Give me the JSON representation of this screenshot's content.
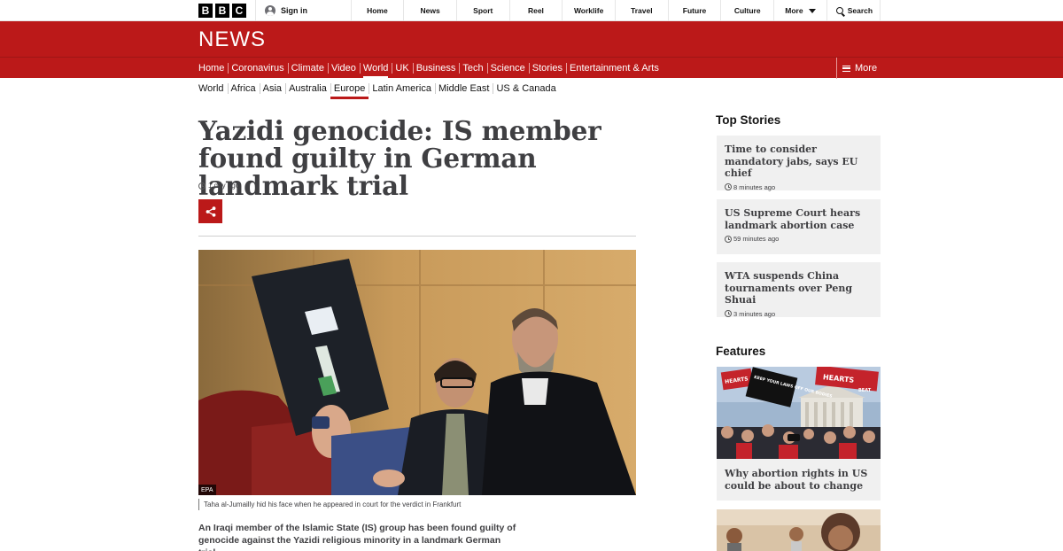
{
  "global_nav": {
    "logo_letters": [
      "B",
      "B",
      "C"
    ],
    "sign_in": "Sign in",
    "items": [
      "Home",
      "News",
      "Sport",
      "Reel",
      "Worklife",
      "Travel",
      "Future",
      "Culture"
    ],
    "more": "More",
    "search": "Search"
  },
  "masthead": {
    "title": "NEWS",
    "brand_color": "#bb1919"
  },
  "news_nav": {
    "items": [
      "Home",
      "Coronavirus",
      "Climate",
      "Video",
      "World",
      "UK",
      "Business",
      "Tech",
      "Science",
      "Stories",
      "Entertainment & Arts"
    ],
    "active": "World",
    "more": "More"
  },
  "sub_nav": {
    "items": [
      "World",
      "Africa",
      "Asia",
      "Australia",
      "Europe",
      "Latin America",
      "Middle East",
      "US & Canada"
    ],
    "active": "Europe"
  },
  "article": {
    "headline": "Yazidi genocide: IS member found guilty in German landmark trial",
    "timestamp": "1 day ago",
    "image_credit": "EPA",
    "caption": "Taha al-Jumailly hid his face when he appeared in court for the verdict in Frankfurt",
    "intro": "An Iraqi member of the Islamic State (IS) group has been found guilty of genocide against the Yazidi religious minority in a landmark German trial."
  },
  "sidebar": {
    "top_stories_heading": "Top Stories",
    "top_stories": [
      {
        "title": "Time to consider mandatory jabs, says EU chief",
        "time": "8 minutes ago"
      },
      {
        "title": "US Supreme Court hears landmark abortion case",
        "time": "59 minutes ago"
      },
      {
        "title": "WTA suspends China tournaments over Peng Shuai",
        "time": "3 minutes ago"
      }
    ],
    "features_heading": "Features",
    "features": [
      {
        "title": "Why abortion rights in US could be about to change",
        "sign_texts": [
          "HEARTS",
          "KEEP YOUR LAWS OFF OUR BODIES",
          "HEARTS",
          "BEAT"
        ]
      }
    ]
  }
}
